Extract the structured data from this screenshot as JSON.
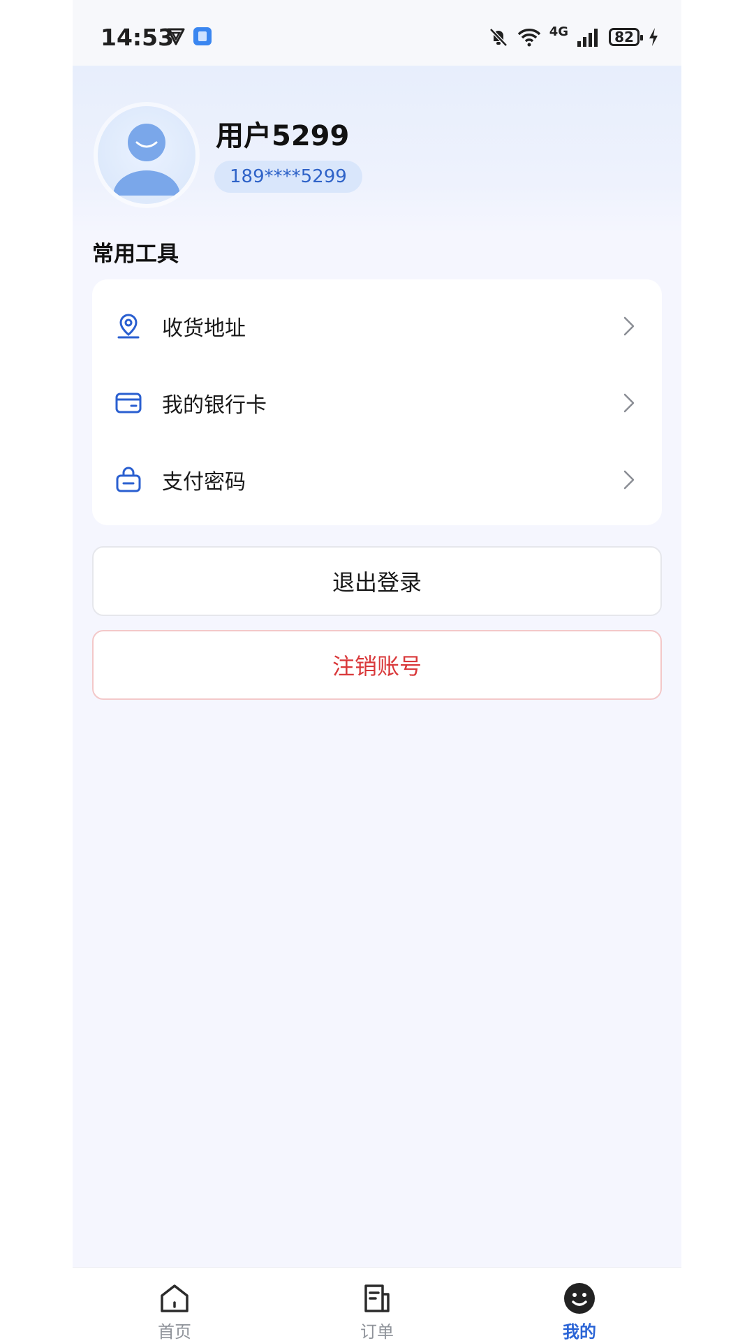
{
  "status_bar": {
    "time": "14:53",
    "network": "4G",
    "battery": "82"
  },
  "profile": {
    "name": "用户5299",
    "phone": "189****5299"
  },
  "tools": {
    "title": "常用工具",
    "items": [
      {
        "label": "收货地址",
        "icon": "location-pin-icon"
      },
      {
        "label": "我的银行卡",
        "icon": "bank-card-icon"
      },
      {
        "label": "支付密码",
        "icon": "lock-icon"
      }
    ]
  },
  "actions": {
    "logout": "退出登录",
    "cancel_account": "注销账号"
  },
  "tabbar": {
    "items": [
      {
        "label": "首页",
        "icon": "home-icon"
      },
      {
        "label": "订单",
        "icon": "orders-icon"
      },
      {
        "label": "我的",
        "icon": "smiley-face-icon",
        "active": true
      }
    ]
  },
  "colors": {
    "accent": "#2a64d6",
    "danger": "#d9383a",
    "background": "#f5f6fe"
  }
}
